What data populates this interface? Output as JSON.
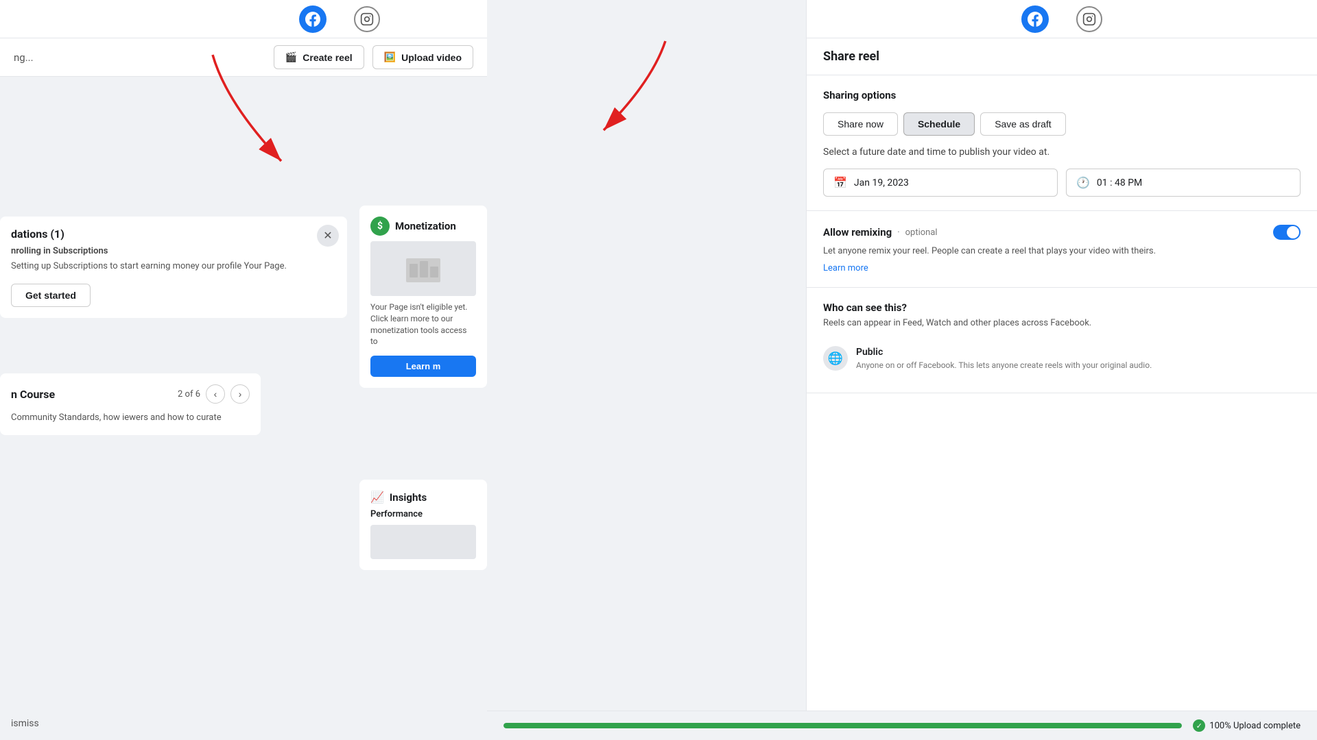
{
  "topbar": {
    "facebook_icon": "f",
    "instagram_icon": "📷"
  },
  "left_panel": {
    "loading_text": "ng...",
    "create_reel_label": "Create reel",
    "upload_video_label": "Upload video",
    "recommendations": {
      "title": "dations (1)",
      "subtitle": "nrolling in Subscriptions",
      "desc": "Setting up Subscriptions to start earning money\nour profile Your Page.",
      "get_started": "Get started"
    },
    "course": {
      "title": "n Course",
      "counter": "2 of 6",
      "desc": "Community Standards, how\niewers and how to curate"
    },
    "dismiss": "ismiss"
  },
  "monetization": {
    "icon": "$",
    "title": "Monetization",
    "desc": "Your Page isn't eligible yet. Click learn more to our monetization tools access to",
    "learn_more_btn": "Learn m"
  },
  "insights": {
    "icon": "📈",
    "title": "Insights",
    "performance_label": "Performance"
  },
  "share_reel": {
    "title": "Share reel",
    "sharing_options_label": "Sharing options",
    "buttons": {
      "share_now": "Share now",
      "schedule": "Schedule",
      "save_as_draft": "Save as draft"
    },
    "schedule_desc": "Select a future date and time to publish your video at.",
    "date_value": "Jan 19, 2023",
    "time_value": "01 : 48 PM",
    "allow_remixing": {
      "title": "Allow remixing",
      "optional": "optional",
      "desc": "Let anyone remix your reel. People can create a reel that plays your video with theirs.",
      "learn_more": "Learn more"
    },
    "who_can_see": {
      "title": "Who can see this?",
      "desc": "Reels can appear in Feed, Watch and other places across Facebook.",
      "audience_name": "Public",
      "audience_desc": "Anyone on or off Facebook. This lets anyone create reels with your original audio."
    }
  },
  "upload_progress": {
    "percent": 100,
    "text": "100% Upload complete"
  }
}
